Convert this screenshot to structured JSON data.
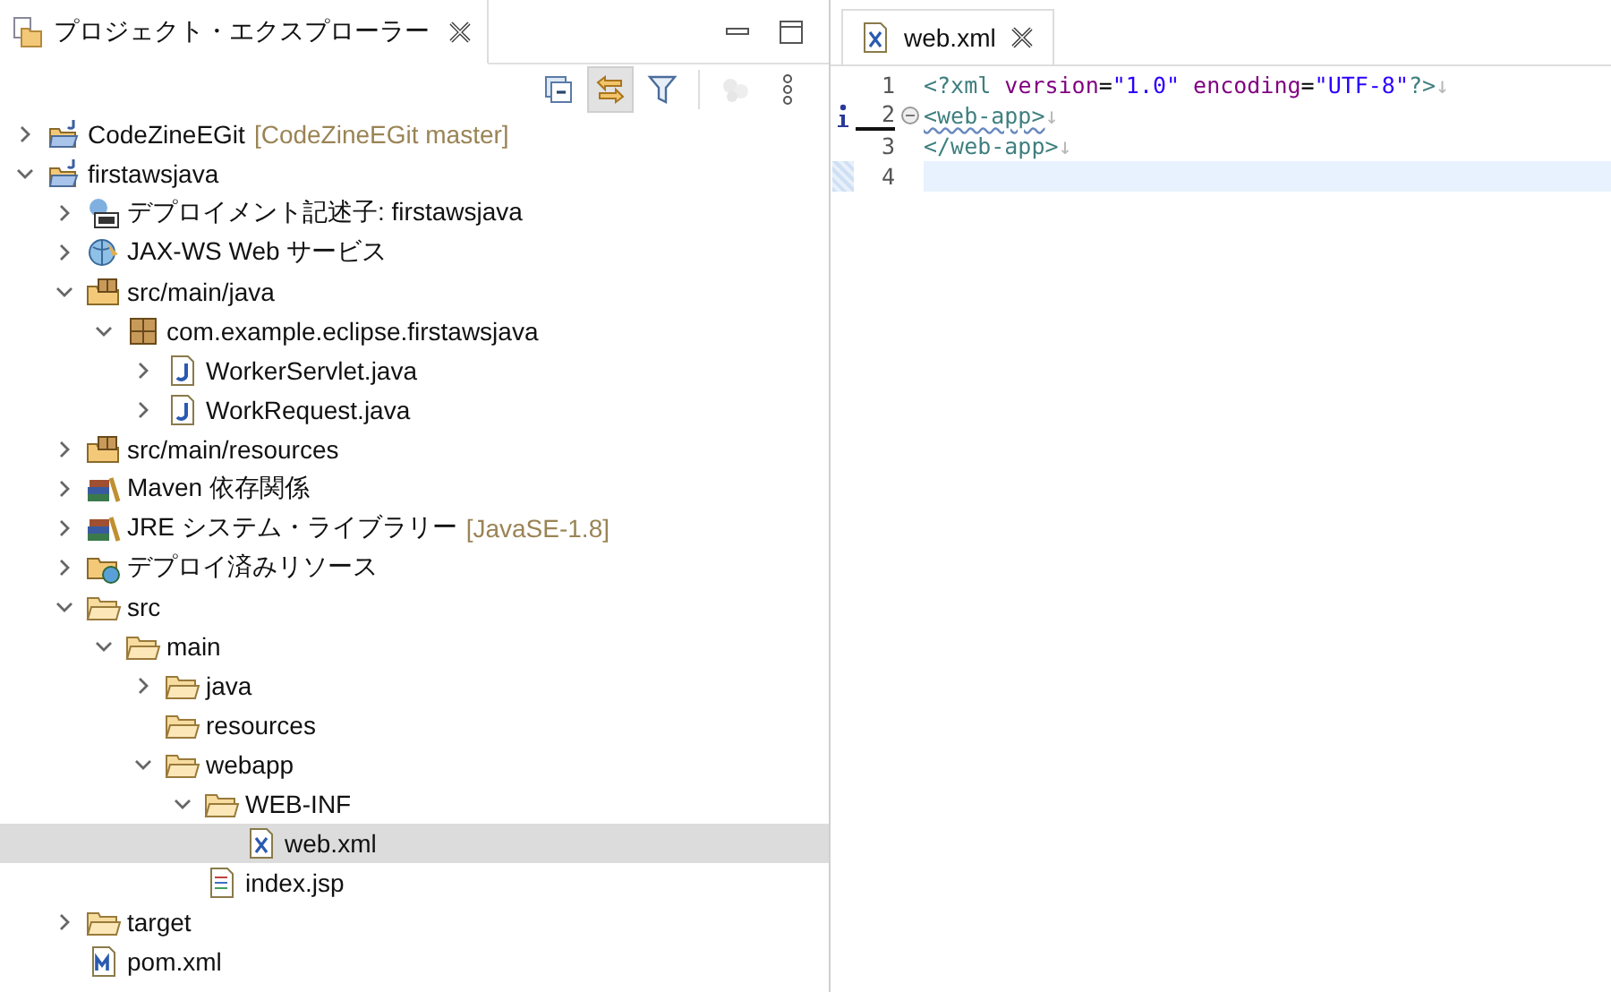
{
  "explorer": {
    "title": "プロジェクト・エクスプローラー",
    "toolbar": [
      {
        "kind": "collapse",
        "pressed": false,
        "disabled": false
      },
      {
        "kind": "link",
        "pressed": true,
        "disabled": false
      },
      {
        "kind": "filter",
        "pressed": false,
        "disabled": false
      },
      {
        "kind": "plugins",
        "pressed": false,
        "disabled": true
      },
      {
        "kind": "more",
        "pressed": false,
        "disabled": false
      }
    ],
    "tree": [
      {
        "label": "CodeZineEGit",
        "decoration": "[CodeZineEGit master]",
        "kind": "project",
        "expanded": false,
        "selected": false
      },
      {
        "label": "firstawsjava",
        "kind": "project",
        "expanded": true,
        "selected": false,
        "children": [
          {
            "label": "デプロイメント記述子: firstawsjava",
            "kind": "descriptor",
            "expanded": false,
            "selected": false
          },
          {
            "label": "JAX-WS Web サービス",
            "kind": "webservice",
            "expanded": false,
            "selected": false
          },
          {
            "label": "src/main/java",
            "kind": "srcfolder",
            "expanded": true,
            "selected": false,
            "children": [
              {
                "label": "com.example.eclipse.firstawsjava",
                "kind": "package",
                "expanded": true,
                "selected": false,
                "children": [
                  {
                    "label": "WorkerServlet.java",
                    "kind": "java",
                    "expanded": false,
                    "selected": false
                  },
                  {
                    "label": "WorkRequest.java",
                    "kind": "java",
                    "expanded": false,
                    "selected": false
                  }
                ]
              }
            ]
          },
          {
            "label": "src/main/resources",
            "kind": "srcfolder",
            "expanded": false,
            "selected": false
          },
          {
            "label": "Maven 依存関係",
            "kind": "library",
            "expanded": false,
            "selected": false
          },
          {
            "label": "JRE システム・ライブラリー",
            "decoration": "[JavaSE-1.8]",
            "kind": "library",
            "expanded": false,
            "selected": false
          },
          {
            "label": "デプロイ済みリソース",
            "kind": "deployed",
            "expanded": false,
            "selected": false
          },
          {
            "label": "src",
            "kind": "folder",
            "expanded": true,
            "selected": false,
            "children": [
              {
                "label": "main",
                "kind": "folder",
                "expanded": true,
                "selected": false,
                "children": [
                  {
                    "label": "java",
                    "kind": "folder",
                    "expanded": false,
                    "selected": false
                  },
                  {
                    "label": "resources",
                    "kind": "folder",
                    "selected": false
                  },
                  {
                    "label": "webapp",
                    "kind": "folder",
                    "expanded": true,
                    "selected": false,
                    "children": [
                      {
                        "label": "WEB-INF",
                        "kind": "folder",
                        "expanded": true,
                        "selected": false,
                        "children": [
                          {
                            "label": "web.xml",
                            "kind": "xml",
                            "selected": true
                          }
                        ]
                      },
                      {
                        "label": "index.jsp",
                        "kind": "jsp",
                        "selected": false
                      }
                    ]
                  }
                ]
              }
            ]
          },
          {
            "label": "target",
            "kind": "folder",
            "expanded": false,
            "selected": false
          },
          {
            "label": "pom.xml",
            "kind": "pom",
            "selected": false
          }
        ]
      }
    ]
  },
  "editor": {
    "tab": {
      "title": "web.xml",
      "selected": true
    },
    "lines": [
      {
        "number": "1",
        "info": false,
        "tokens": [
          {
            "text": "<?xml",
            "kind": "tag"
          },
          {
            "text": " version",
            "kind": "attr"
          },
          {
            "text": "=",
            "kind": "plain"
          },
          {
            "text": "\"1.0\"",
            "kind": "string"
          },
          {
            "text": " encoding",
            "kind": "attr"
          },
          {
            "text": "=",
            "kind": "plain"
          },
          {
            "text": "\"UTF-8\"",
            "kind": "string"
          },
          {
            "text": "?>",
            "kind": "tag"
          },
          {
            "text": "↓",
            "kind": "whitespace"
          }
        ]
      },
      {
        "number": "2",
        "info": true,
        "foldable": true,
        "tokens": [
          {
            "text": "<web-app>",
            "kind": "tag"
          },
          {
            "text": "↓",
            "kind": "whitespace"
          }
        ]
      },
      {
        "number": "3",
        "info": false,
        "tokens": [
          {
            "text": "</web-app>",
            "kind": "tag"
          },
          {
            "text": "↓",
            "kind": "whitespace"
          }
        ]
      },
      {
        "number": "4",
        "current": true,
        "info": false
      }
    ]
  }
}
